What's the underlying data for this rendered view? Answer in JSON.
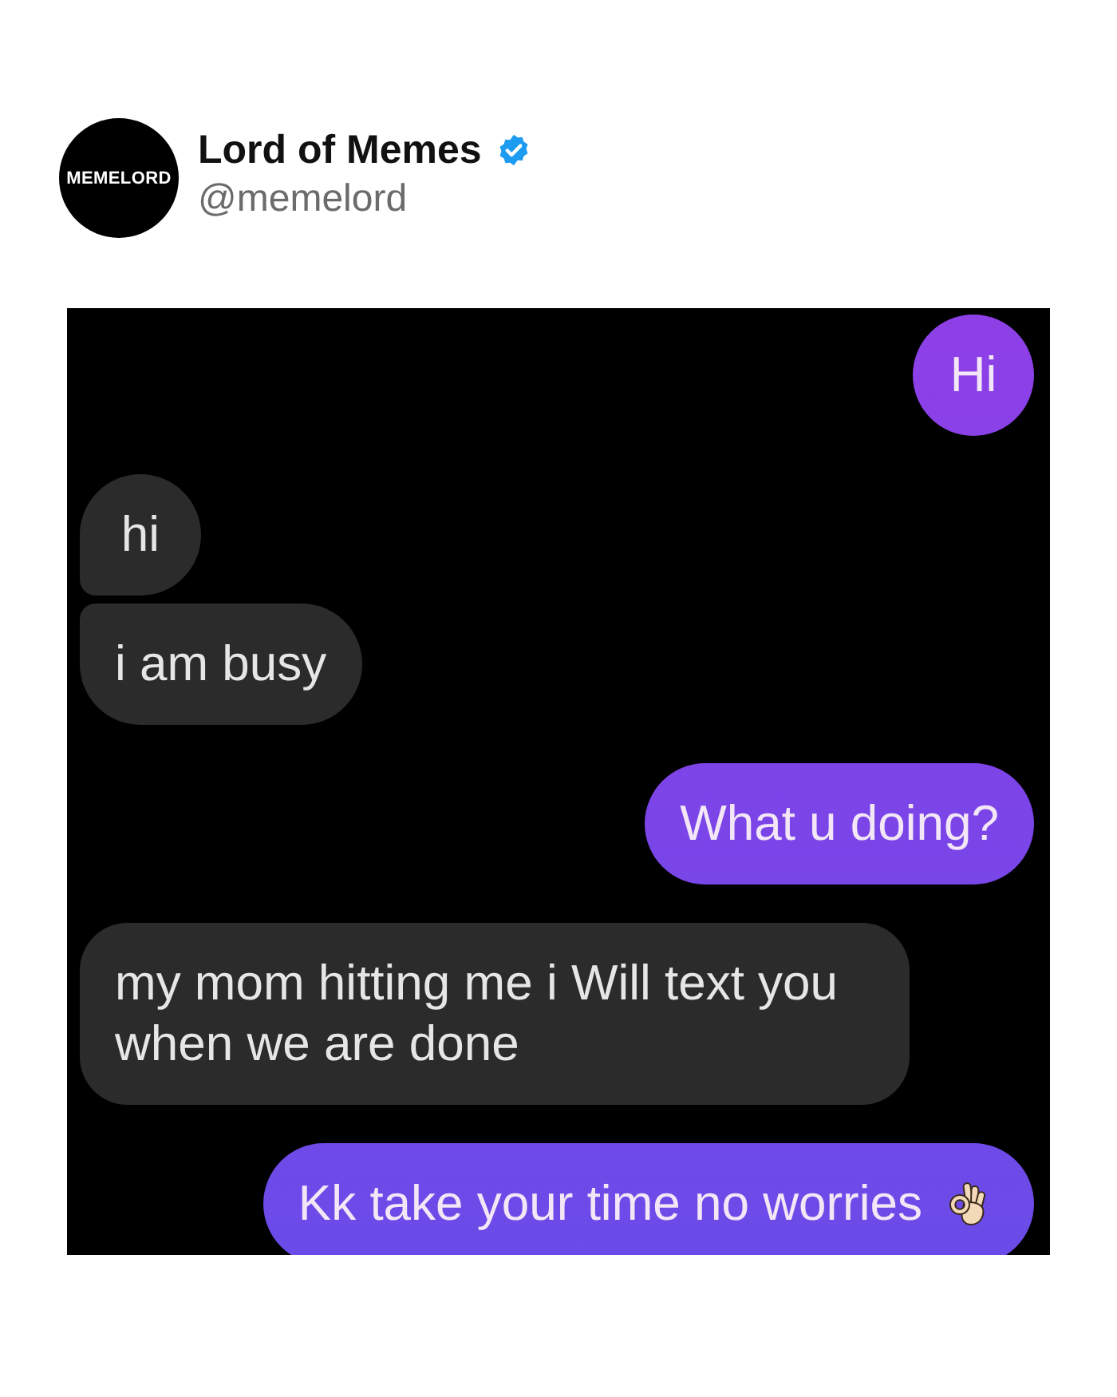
{
  "post": {
    "author": {
      "avatar_text": "MEMELORD",
      "name": "Lord of Memes",
      "verified": true,
      "handle": "@memelord"
    }
  },
  "chat": {
    "messages": [
      {
        "kind": "sent",
        "text": "Hi",
        "emoji": false
      },
      {
        "kind": "received",
        "text": "hi",
        "emoji": false
      },
      {
        "kind": "received",
        "text": "i am busy",
        "emoji": false
      },
      {
        "kind": "sent",
        "text": "What u doing?",
        "emoji": false
      },
      {
        "kind": "received",
        "text": "my mom hitting me i Will text you when we are done",
        "emoji": false
      },
      {
        "kind": "sent",
        "text": "Kk take your time no worries",
        "emoji": true
      }
    ]
  }
}
